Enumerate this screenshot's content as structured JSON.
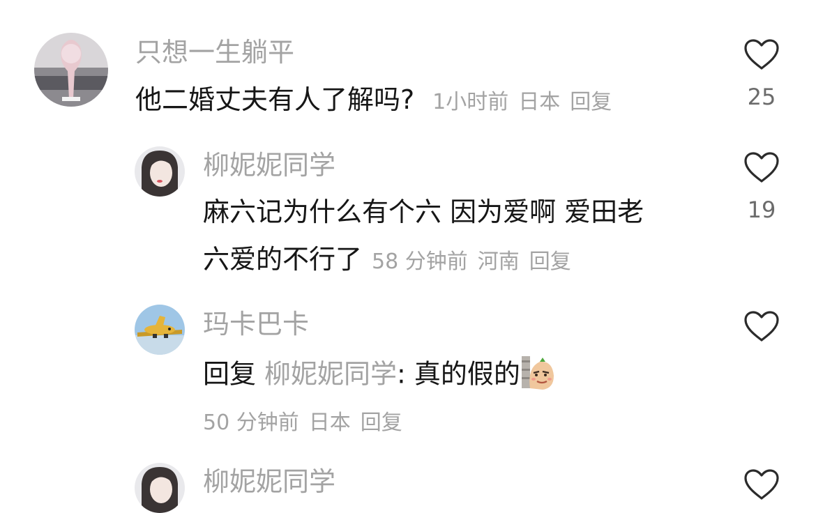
{
  "comments": [
    {
      "username": "只想一生躺平",
      "text": "他二婚丈夫有人了解吗?",
      "time": "1小时前",
      "location": "日本",
      "reply_label": "回复",
      "likes": "25"
    },
    {
      "username": "柳妮妮同学",
      "text_line1": "麻六记为什么有个六 因为爱啊 爱田老",
      "text_line2": "六爱的不行了",
      "time": "58 分钟前",
      "location": "河南",
      "reply_label": "回复",
      "likes": "19"
    },
    {
      "username": "玛卡巴卡",
      "reply_prefix": "回复",
      "reply_to": "柳妮妮同学",
      "text": ": 真的假的",
      "emoji_icon": "smirk-potato-emoji",
      "time": "50 分钟前",
      "location": "日本",
      "reply_label": "回复"
    },
    {
      "username": "柳妮妮同学"
    }
  ],
  "colors": {
    "primary_text": "#161616",
    "secondary_text": "#a3a3a3",
    "count_text": "#6b6b6b"
  }
}
